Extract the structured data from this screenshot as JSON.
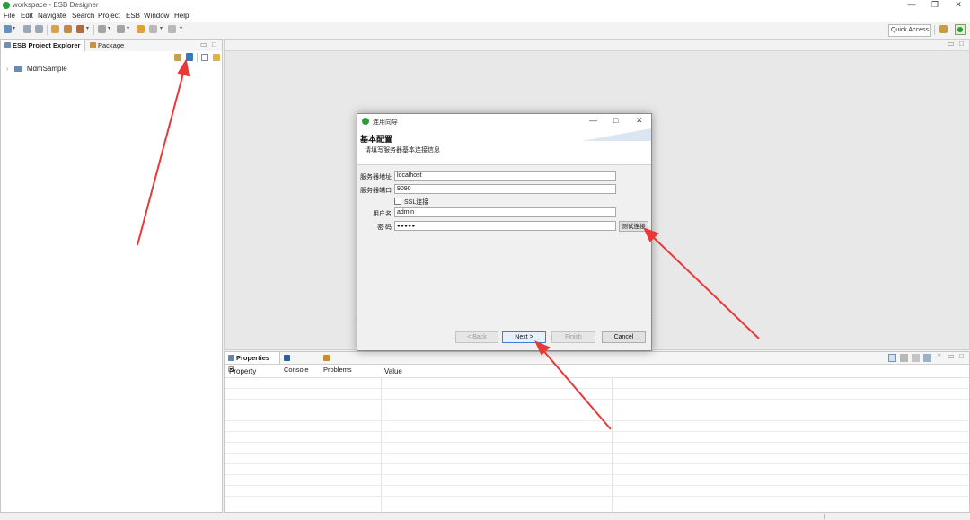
{
  "window": {
    "title": "workspace - ESB Designer",
    "controls": [
      "—",
      "❐",
      "✕"
    ]
  },
  "menu": [
    "File",
    "Edit",
    "Navigate",
    "Search",
    "Project",
    "ESB",
    "Window",
    "Help"
  ],
  "toolbar": {
    "quick_access": "Quick Access"
  },
  "left_view": {
    "tabs": [
      {
        "label": "ESB Project Explorer ☒"
      },
      {
        "label": "Package Explorer"
      }
    ],
    "tree": [
      {
        "label": "MdmSample"
      }
    ]
  },
  "bottom": {
    "tabs": [
      {
        "label": "Properties ☒"
      },
      {
        "label": "Console"
      },
      {
        "label": "Problems"
      }
    ],
    "columns": [
      "Property",
      "Value"
    ]
  },
  "dialog": {
    "title": "连用向导",
    "heading": "基本配置",
    "subheading": "请填写服务器基本连接信息",
    "fields": {
      "server_address": {
        "label": "服务器地址",
        "value": "localhost"
      },
      "server_port": {
        "label": "服务器端口",
        "value": "9090"
      },
      "ssl": {
        "label": "SSL连接"
      },
      "username": {
        "label": "用户名",
        "value": "admin"
      },
      "password": {
        "label": "密 码",
        "value": "●●●●●"
      }
    },
    "test_button": "测试连接",
    "buttons": {
      "back": "< Back",
      "next": "Next >",
      "finish": "Finish",
      "cancel": "Cancel"
    }
  },
  "colors": {
    "accent_green": "#2e9b3a",
    "annotation_red": "#e8393a",
    "default_button_border": "#3c7fd5"
  }
}
